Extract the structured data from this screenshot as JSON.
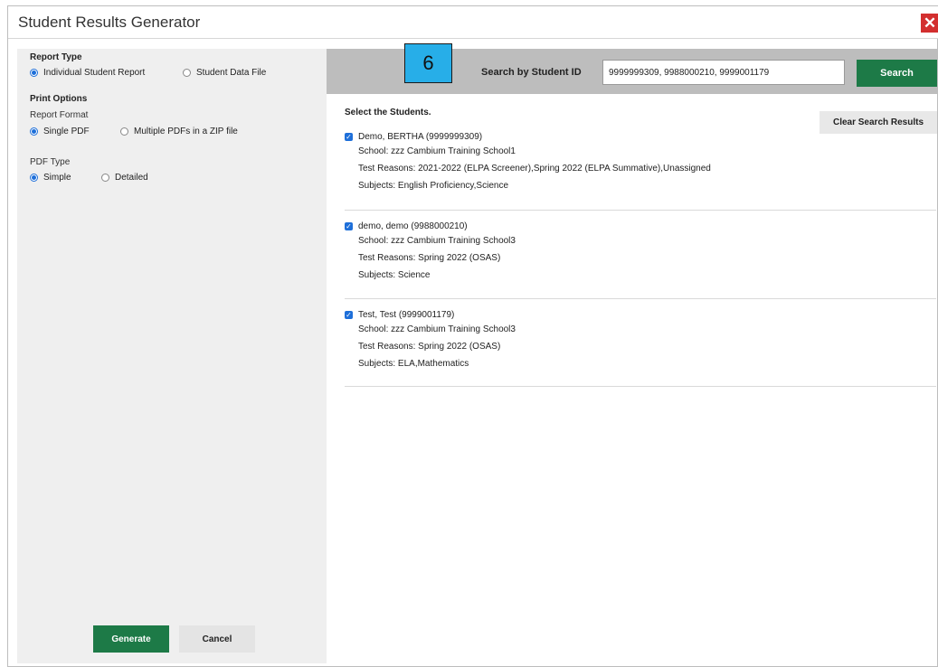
{
  "dialog": {
    "title": "Student Results Generator",
    "close_icon": "close-icon"
  },
  "left": {
    "report_type": {
      "title": "Report Type",
      "options": [
        {
          "label": "Individual Student Report",
          "selected": true
        },
        {
          "label": "Student Data File",
          "selected": false
        }
      ]
    },
    "print_options": {
      "title": "Print Options",
      "report_format": {
        "title": "Report Format",
        "options": [
          {
            "label": "Single PDF",
            "selected": true
          },
          {
            "label": "Multiple PDFs in a ZIP file",
            "selected": false
          }
        ]
      },
      "pdf_type": {
        "title": "PDF Type",
        "options": [
          {
            "label": "Simple",
            "selected": true
          },
          {
            "label": "Detailed",
            "selected": false
          }
        ]
      }
    },
    "generate_label": "Generate",
    "cancel_label": "Cancel"
  },
  "search": {
    "step_number": "6",
    "label": "Search by Student ID",
    "value": "9999999309, 9988000210, 9999001179",
    "button_label": "Search"
  },
  "results": {
    "title": "Select the Students.",
    "clear_label": "Clear Search Results",
    "students": [
      {
        "name": "Demo, BERTHA (9999999309)",
        "school": "School: zzz Cambium Training School1",
        "reasons": "Test Reasons: 2021-2022 (ELPA Screener),Spring 2022 (ELPA Summative),Unassigned",
        "subjects": "Subjects: English Proficiency,Science",
        "checked": true
      },
      {
        "name": "demo, demo (9988000210)",
        "school": "School: zzz Cambium Training School3",
        "reasons": "Test Reasons: Spring 2022 (OSAS)",
        "subjects": "Subjects: Science",
        "checked": true
      },
      {
        "name": "Test, Test (9999001179)",
        "school": "School: zzz Cambium Training School3",
        "reasons": "Test Reasons: Spring 2022 (OSAS)",
        "subjects": "Subjects: ELA,Mathematics",
        "checked": true
      }
    ]
  },
  "colors": {
    "accent_green": "#1d7a47",
    "radio_blue": "#1e6fd9",
    "close_red": "#d32f2f",
    "step_badge": "#27aee8"
  }
}
